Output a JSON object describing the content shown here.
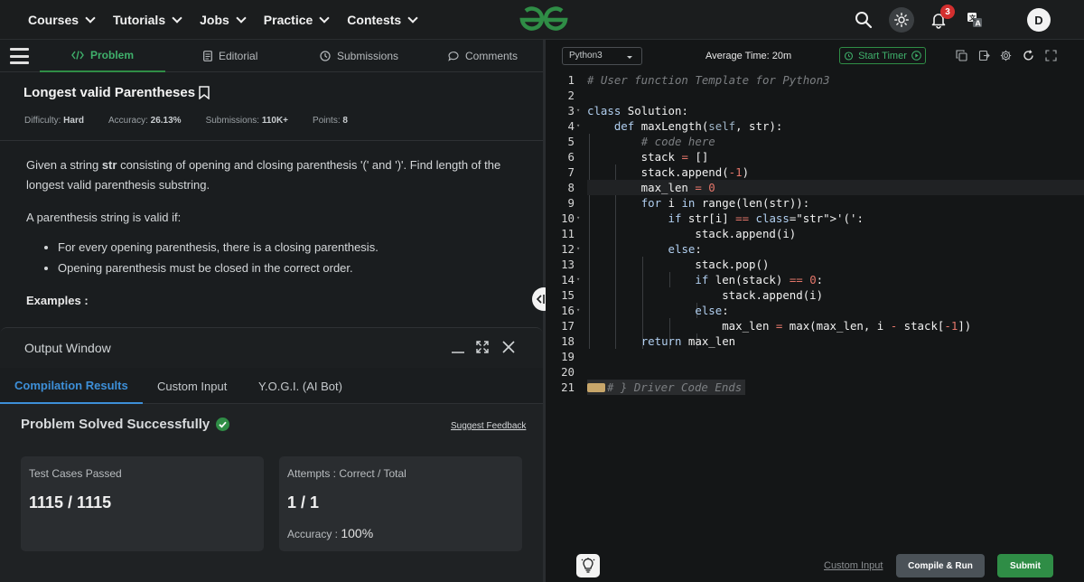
{
  "nav": {
    "items": [
      {
        "label": "Courses"
      },
      {
        "label": "Tutorials"
      },
      {
        "label": "Jobs"
      },
      {
        "label": "Practice"
      },
      {
        "label": "Contests"
      }
    ],
    "notification_count": "3",
    "avatar_initial": "D",
    "brand_color": "#2f8d46"
  },
  "problem_tabs": {
    "problem": "Problem",
    "editorial": "Editorial",
    "submissions": "Submissions",
    "comments": "Comments"
  },
  "problem": {
    "title": "Longest valid Parentheses",
    "difficulty_label": "Difficulty:",
    "difficulty": "Hard",
    "accuracy_label": "Accuracy:",
    "accuracy": "26.13%",
    "submissions_label": "Submissions:",
    "submissions": "110K+",
    "points_label": "Points:",
    "points": "8",
    "desc_prefix": "Given a string ",
    "desc_bold": "str",
    "desc_suffix": " consisting of opening and closing parenthesis '(' and ')'. Find length of the longest valid parenthesis substring.",
    "valid_intro": "A parenthesis string is valid if:",
    "rules": [
      "For every opening parenthesis, there is a closing parenthesis.",
      "Opening parenthesis must be closed in the correct order."
    ],
    "examples_label": "Examples :"
  },
  "output": {
    "title": "Output Window",
    "tabs": [
      "Compilation Results",
      "Custom Input",
      "Y.O.G.I. (AI Bot)"
    ],
    "status": "Problem Solved Successfully",
    "feedback": "Suggest Feedback",
    "tests_label": "Test Cases Passed",
    "tests_value": "1115 / 1115",
    "attempts_label": "Attempts : Correct / Total",
    "attempts_value": "1 / 1",
    "accuracy_label": "Accuracy :",
    "accuracy_value": "100%"
  },
  "editor": {
    "language": "Python3",
    "avg_time": "Average Time: 20m",
    "start_timer": "Start Timer",
    "custom_input": "Custom Input",
    "compile_run": "Compile & Run",
    "submit": "Submit",
    "line_numbers": [
      "1",
      "2",
      "3",
      "4",
      "5",
      "6",
      "7",
      "8",
      "9",
      "10",
      "11",
      "12",
      "13",
      "14",
      "15",
      "16",
      "17",
      "18",
      "19",
      "20",
      "21"
    ],
    "code_lines": [
      "# User function Template for Python3",
      "",
      "class Solution:",
      "    def maxLength(self, str):",
      "        # code here",
      "        stack = []",
      "        stack.append(-1)",
      "        max_len = 0",
      "        for i in range(len(str)):",
      "            if str[i] == '(':",
      "                stack.append(i)",
      "            else:",
      "                stack.pop()",
      "                if len(stack) == 0:",
      "                    stack.append(i)",
      "                else:",
      "                    max_len = max(max_len, i - stack[-1])",
      "        return max_len",
      "",
      "",
      "# } Driver Code Ends"
    ]
  }
}
